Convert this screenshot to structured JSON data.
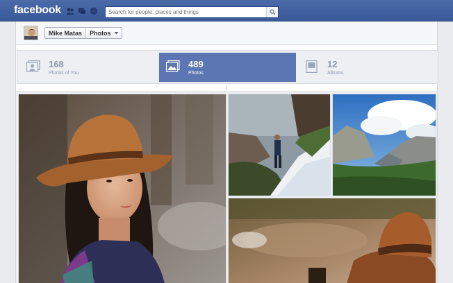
{
  "header": {
    "logo": "facebook",
    "search_placeholder": "Search for people, places and things"
  },
  "profile": {
    "name": "Mike Matas",
    "section": "Photos"
  },
  "stats": [
    {
      "count": "168",
      "label": "Photos of You",
      "active": false,
      "icon": "photos-of-you-icon"
    },
    {
      "count": "489",
      "label": "Photos",
      "active": true,
      "icon": "photos-icon"
    },
    {
      "count": "12",
      "label": "Albums",
      "active": false,
      "icon": "albums-icon"
    }
  ],
  "photos": [
    {
      "subject": "woman-in-brown-hat"
    },
    {
      "subject": "hiker-on-snowy-cliff"
    },
    {
      "subject": "yosemite-valley"
    },
    {
      "subject": "brown-hat-on-trail"
    }
  ],
  "colors": {
    "facebook_blue": "#3b5998",
    "active_tab": "#5b76b3",
    "stat_text": "#8a95ad"
  }
}
